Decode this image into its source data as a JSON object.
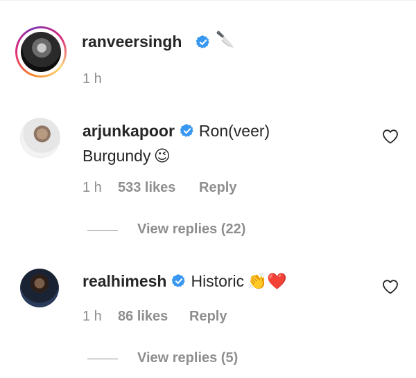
{
  "post": {
    "username": "ranveersingh",
    "verified": true,
    "caption_emoji": "🔪",
    "time": "1 h"
  },
  "comments": [
    {
      "username": "arjunkapoor",
      "verified": true,
      "text_line1": "Ron(veer)",
      "text_line2": "Burgundy",
      "text_emoji": "😉",
      "time": "1 h",
      "likes": "533 likes",
      "reply_label": "Reply",
      "view_replies": "View replies (22)"
    },
    {
      "username": "realhimesh",
      "verified": true,
      "text": "Historic",
      "text_emoji": "👏❤️",
      "time": "1 h",
      "likes": "86 likes",
      "reply_label": "Reply",
      "view_replies": "View replies (5)"
    }
  ],
  "icons": {
    "verified": "verified-badge-icon",
    "like": "heart-outline-icon"
  },
  "colors": {
    "verified_blue": "#3897f0",
    "text": "#262626",
    "secondary": "#8e8e8e"
  }
}
